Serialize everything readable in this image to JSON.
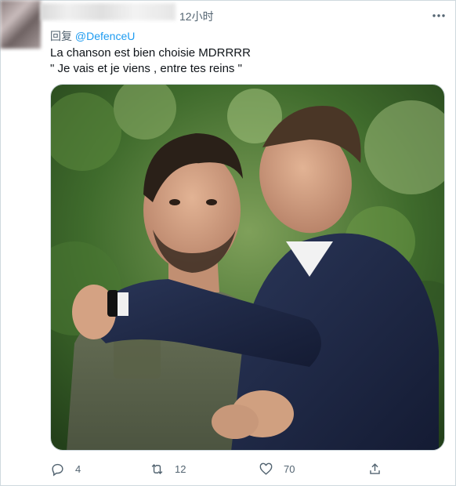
{
  "tweet": {
    "timestamp": "12小时",
    "reply_prefix": "回复",
    "reply_to": "@DefenceU",
    "text_lines": [
      "La chanson est bien choisie MDRRRR",
      "\" Je vais et je viens , entre tes reins \""
    ],
    "media": {
      "description_icon": "photo-two-men-embracing"
    }
  },
  "actions": {
    "reply_count": "4",
    "retweet_count": "12",
    "like_count": "70",
    "reply_icon": "reply-icon",
    "retweet_icon": "retweet-icon",
    "like_icon": "heart-icon",
    "share_icon": "share-icon"
  },
  "colors": {
    "link": "#1d9bf0",
    "secondary_text": "#536471",
    "border": "#cfd9de"
  }
}
